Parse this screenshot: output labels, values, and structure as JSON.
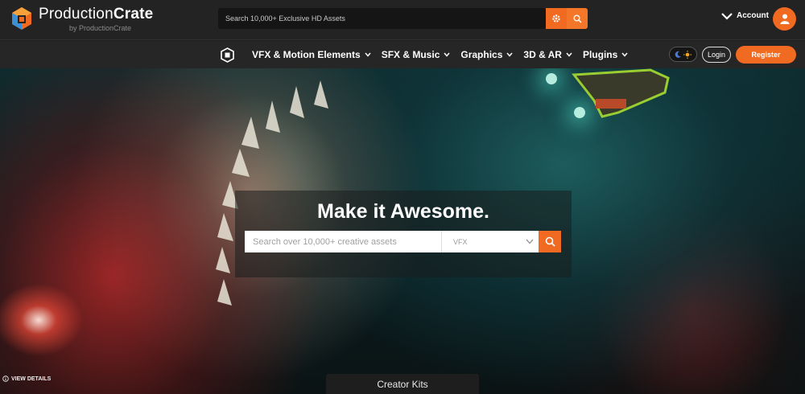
{
  "brand": {
    "name_bold": "Production",
    "name_rest": "Crate",
    "tagline": "by ProductionCrate"
  },
  "top_search": {
    "placeholder": "Search 10,000+ Exclusive HD Assets"
  },
  "account": {
    "label": "Account"
  },
  "nav": {
    "items": [
      {
        "label": "VFX & Motion Elements"
      },
      {
        "label": "SFX & Music"
      },
      {
        "label": "Graphics"
      },
      {
        "label": "3D & AR"
      },
      {
        "label": "Plugins"
      }
    ],
    "login_label": "Login",
    "register_label": "Register"
  },
  "hero": {
    "headline": "Make it Awesome.",
    "search_placeholder": "Search over 10,000+ creative assets",
    "category_selected": "VFX",
    "view_details_label": "VIEW DETAILS",
    "creator_kits_label": "Creator Kits"
  },
  "colors": {
    "accent": "#f06a21",
    "topbar": "#232323",
    "navbar": "#262626"
  },
  "icons": [
    "productioncrate-logo",
    "gear-icon",
    "search-icon",
    "chevron-down-icon",
    "user-icon",
    "moon-icon",
    "sun-icon",
    "info-icon"
  ]
}
